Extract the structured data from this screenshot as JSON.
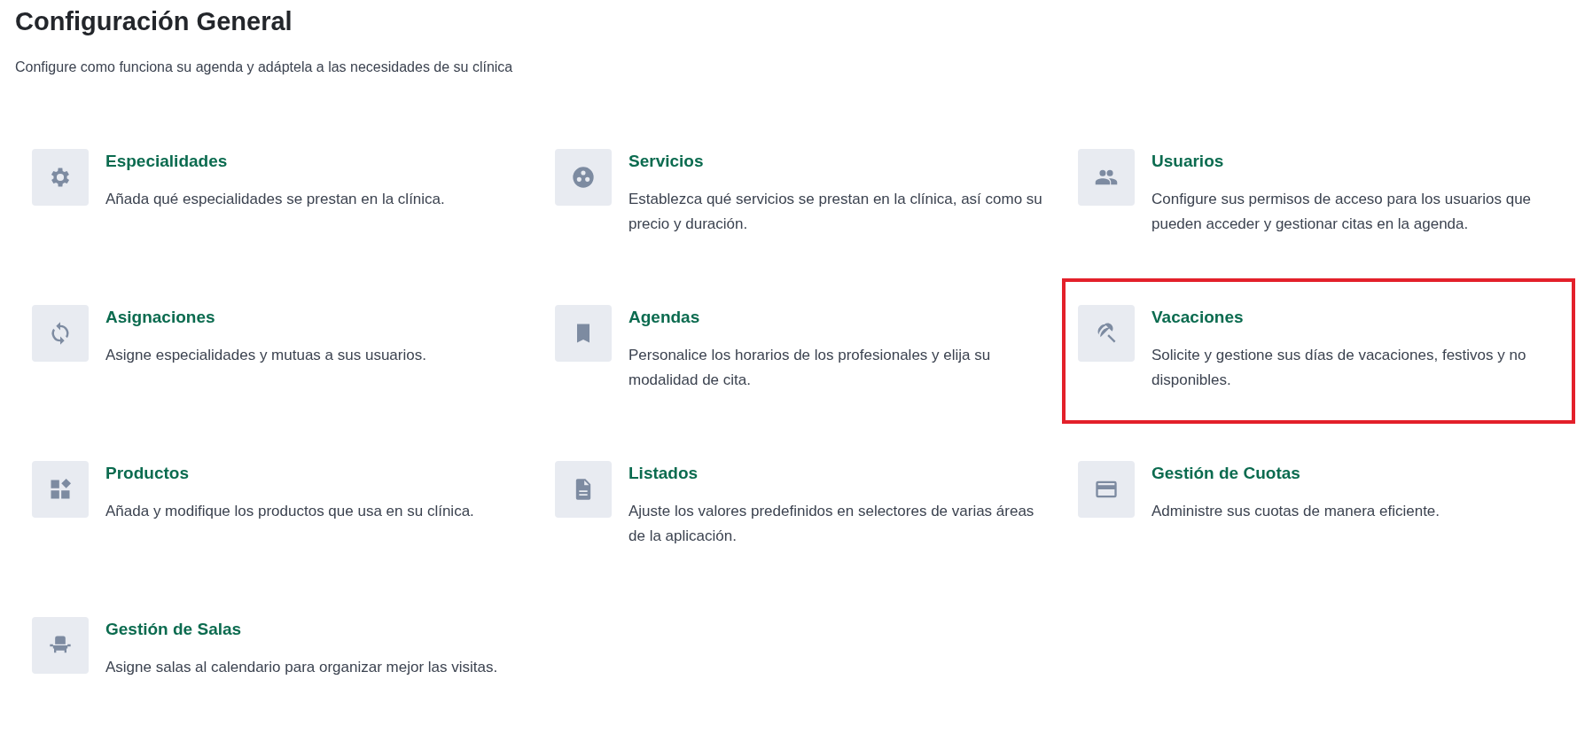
{
  "header": {
    "title": "Configuración General",
    "subtitle": "Configure como funciona su agenda y adáptela a las necesidades de su clínica"
  },
  "sections": [
    {
      "kind": "gear",
      "title": "Especialidades",
      "description": "Añada qué especialidades se prestan en la clínica.",
      "highlighted": false
    },
    {
      "kind": "dots",
      "title": "Servicios",
      "description": "Establezca qué servicios se prestan en la clínica, así como su precio y duración.",
      "highlighted": false
    },
    {
      "kind": "people",
      "title": "Usuarios",
      "description": "Configure sus permisos de acceso para los usuarios que pueden acceder y gestionar citas en la agenda.",
      "highlighted": false
    },
    {
      "kind": "sync",
      "title": "Asignaciones",
      "description": "Asigne especialidades y mutuas a sus usuarios.",
      "highlighted": false
    },
    {
      "kind": "bookmark",
      "title": "Agendas",
      "description": "Personalice los horarios de los profesionales y elija su modalidad de cita.",
      "highlighted": false
    },
    {
      "kind": "umbrella",
      "title": "Vacaciones",
      "description": "Solicite y gestione sus días de vacaciones, festivos y no disponibles.",
      "highlighted": true
    },
    {
      "kind": "widgets",
      "title": "Productos",
      "description": "Añada y modifique los productos que usa en su clínica.",
      "highlighted": false
    },
    {
      "kind": "document",
      "title": "Listados",
      "description": "Ajuste los valores predefinidos en selectores de varias áreas de la aplicación.",
      "highlighted": false
    },
    {
      "kind": "card",
      "title": "Gestión de Cuotas",
      "description": "Administre sus cuotas de manera eficiente.",
      "highlighted": false
    },
    {
      "kind": "chair",
      "title": "Gestión de Salas",
      "description": "Asigne salas al calendario para organizar mejor las visitas.",
      "highlighted": false
    }
  ]
}
